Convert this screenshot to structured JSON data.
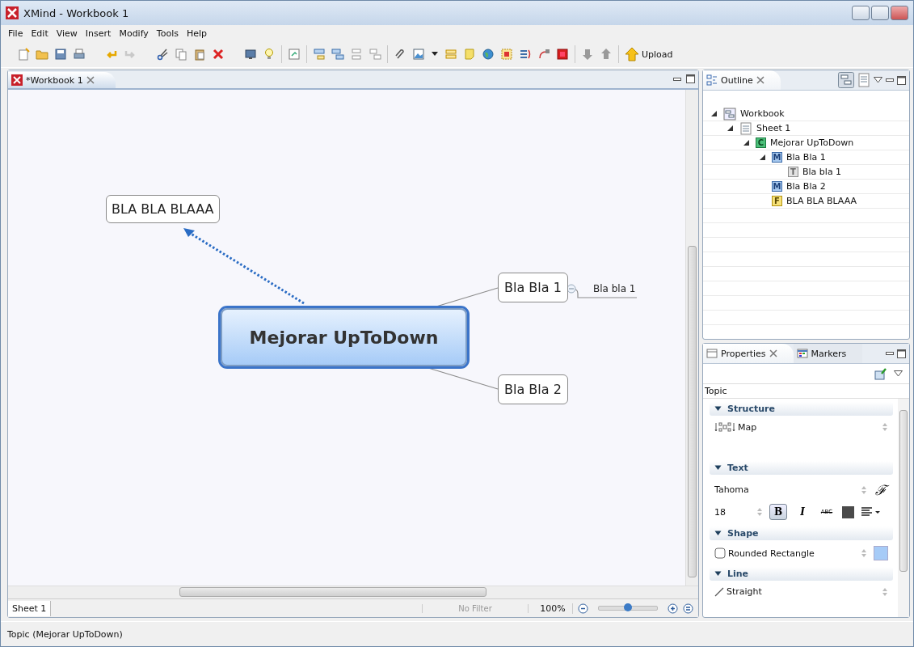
{
  "window": {
    "title": "XMind - Workbook 1"
  },
  "menu": [
    "File",
    "Edit",
    "View",
    "Insert",
    "Modify",
    "Tools",
    "Help"
  ],
  "toolbar": {
    "upload_label": "Upload"
  },
  "editor": {
    "tab": {
      "label": "*Workbook 1",
      "selected": true
    },
    "topics": [
      {
        "kind": "floating",
        "text": "BLA BLA BLAAA",
        "selected": false
      },
      {
        "kind": "central",
        "text": "Mejorar UpToDown",
        "selected": true
      },
      {
        "kind": "main",
        "text": "Bla Bla 1",
        "selected": false
      },
      {
        "kind": "sub",
        "text": "Bla bla 1",
        "selected": false
      },
      {
        "kind": "main",
        "text": "Bla Bla 2",
        "selected": false
      }
    ],
    "sheet_tabs": [
      {
        "label": "Sheet 1",
        "selected": true
      }
    ],
    "filter": "No Filter",
    "zoom": "100%",
    "zoom_slider": {
      "level": 0.5
    }
  },
  "outline": {
    "tab": {
      "label": "Outline",
      "selected": true
    },
    "tree": [
      {
        "kind": "workbook",
        "label": "Workbook",
        "expanded": true,
        "children": [
          {
            "kind": "sheet",
            "label": "Sheet 1",
            "expanded": true,
            "children": [
              {
                "kind": "central",
                "badge": "C",
                "label": "Mejorar UpToDown",
                "expanded": true,
                "children": [
                  {
                    "kind": "main",
                    "badge": "M",
                    "label": "Bla Bla 1",
                    "expanded": true,
                    "children": [
                      {
                        "kind": "sub",
                        "badge": "T",
                        "label": "Bla bla 1"
                      }
                    ]
                  },
                  {
                    "kind": "main",
                    "badge": "M",
                    "label": "Bla Bla 2"
                  },
                  {
                    "kind": "floating",
                    "badge": "F",
                    "label": "BLA BLA BLAAA"
                  }
                ]
              }
            ]
          }
        ]
      }
    ]
  },
  "properties": {
    "tabs": [
      {
        "label": "Properties",
        "selected": true
      },
      {
        "label": "Markers",
        "selected": false
      }
    ],
    "heading": "Topic",
    "sections": [
      {
        "kind": "structure",
        "title": "Structure",
        "expanded": true,
        "value": "Map"
      },
      {
        "kind": "text",
        "title": "Text",
        "expanded": true,
        "font": "Tahoma",
        "font_button": "ℱ",
        "size": "18",
        "bold": {
          "label": "B",
          "on": true
        },
        "italic": {
          "label": "I",
          "on": false
        },
        "strike": {
          "label": "ABC",
          "on": false
        },
        "color": "#4a4a4a"
      },
      {
        "kind": "shape",
        "title": "Shape",
        "expanded": true,
        "value": "Rounded Rectangle",
        "color": "#a6cbf7"
      },
      {
        "kind": "line",
        "title": "Line",
        "expanded": true,
        "value": "Straight"
      }
    ]
  },
  "status_bar": {
    "text": "Topic (Mejorar UpToDown)"
  }
}
